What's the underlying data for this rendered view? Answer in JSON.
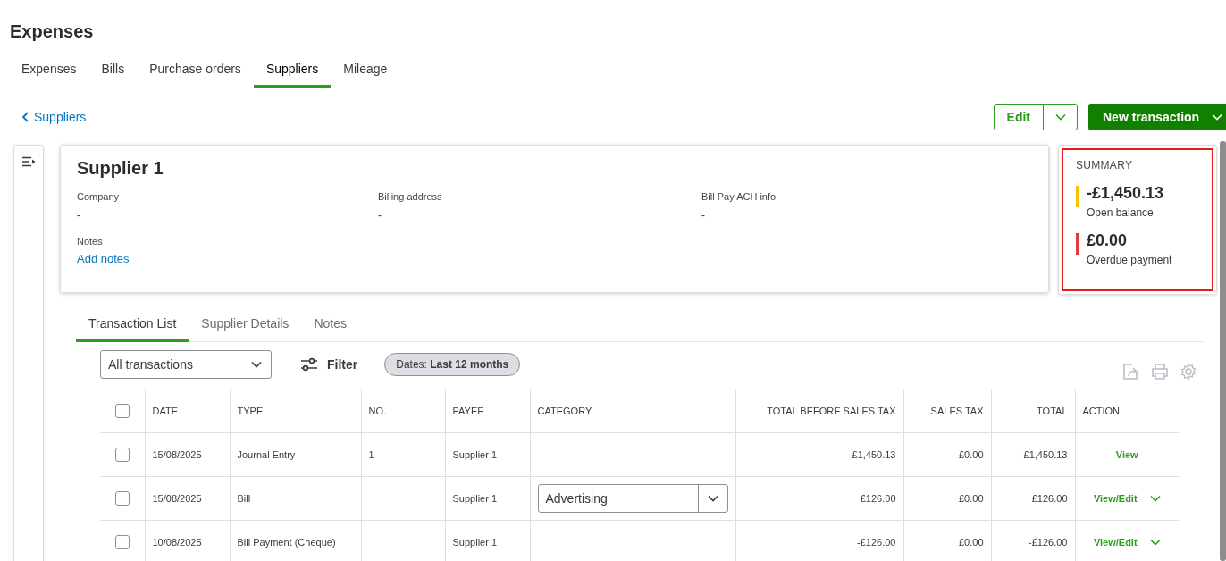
{
  "page_title": "Expenses",
  "tabs": [
    {
      "label": "Expenses",
      "selected": false
    },
    {
      "label": "Bills",
      "selected": false
    },
    {
      "label": "Purchase orders",
      "selected": false
    },
    {
      "label": "Suppliers",
      "selected": true
    },
    {
      "label": "Mileage",
      "selected": false
    }
  ],
  "back_link": "Suppliers",
  "edit_button": "Edit",
  "new_transaction_button": "New transaction",
  "supplier": {
    "name": "Supplier 1",
    "fields": [
      {
        "label": "Company",
        "value": "-"
      },
      {
        "label": "Billing address",
        "value": "-"
      },
      {
        "label": "Bill Pay ACH info",
        "value": "-"
      }
    ],
    "notes_label": "Notes",
    "add_notes_link": "Add notes"
  },
  "summary": {
    "title": "SUMMARY",
    "items": [
      {
        "amount": "-£1,450.13",
        "label": "Open balance",
        "color": "#f5c400"
      },
      {
        "amount": "£0.00",
        "label": "Overdue payment",
        "color": "#e23b3b"
      }
    ]
  },
  "detail_tabs": [
    {
      "label": "Transaction List",
      "selected": true
    },
    {
      "label": "Supplier Details",
      "selected": false
    },
    {
      "label": "Notes",
      "selected": false
    }
  ],
  "toolbar": {
    "type_filter": "All transactions",
    "filter_button": "Filter",
    "date_chip_label": "Dates:",
    "date_chip_value": "Last 12 months"
  },
  "table": {
    "select_all_checked": false,
    "columns": [
      "DATE",
      "TYPE",
      "NO.",
      "PAYEE",
      "CATEGORY",
      "TOTAL BEFORE SALES TAX",
      "SALES TAX",
      "TOTAL",
      "ACTION"
    ],
    "rows": [
      {
        "checked": false,
        "date": "15/08/2025",
        "type": "Journal Entry",
        "no": "1",
        "payee": "Supplier 1",
        "total_before_tax": "-£1,450.13",
        "sales_tax": "£0.00",
        "total": "-£1,450.13",
        "action": "View",
        "action_menu": false
      },
      {
        "checked": false,
        "date": "15/08/2025",
        "type": "Bill",
        "payee": "Supplier 1",
        "category": {
          "kind": "dropdown",
          "value": "Advertising"
        },
        "total_before_tax": "£126.00",
        "sales_tax": "£0.00",
        "total": "£126.00",
        "action": "View/Edit",
        "action_menu": true
      },
      {
        "checked": false,
        "date": "10/08/2025",
        "type": "Bill Payment (Cheque)",
        "payee": "Supplier 1",
        "total_before_tax": "-£126.00",
        "sales_tax": "£0.00",
        "total": "-£126.00",
        "action": "View/Edit",
        "action_menu": true
      }
    ]
  }
}
